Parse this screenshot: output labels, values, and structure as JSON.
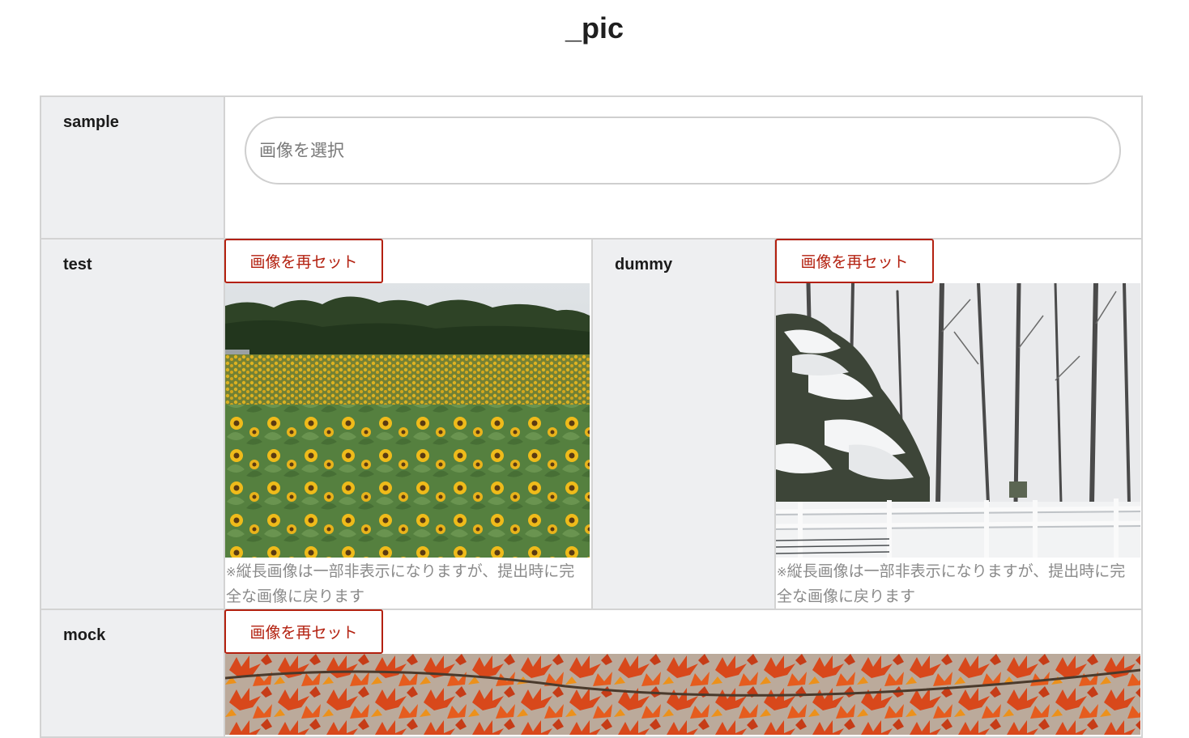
{
  "page": {
    "title": "_pic"
  },
  "fields": [
    {
      "label": "sample",
      "placeholder": "画像を選択"
    },
    {
      "label": "test",
      "reset_label": "画像を再セット",
      "note_mark": "※",
      "note": "縦長画像は一部非表示になりますが、提出時に完全な画像に戻ります",
      "image": "sunflower-field-photo"
    },
    {
      "label": "dummy",
      "reset_label": "画像を再セット",
      "note_mark": "※",
      "note": "縦長画像は一部非表示になりますが、提出時に完全な画像に戻ります",
      "image": "snowy-forest-photo"
    },
    {
      "label": "mock",
      "reset_label": "画像を再セット",
      "image": "autumn-maple-leaves-photo"
    }
  ],
  "colors": {
    "accent": "#b3200f",
    "label_bg": "#eeeff1",
    "border": "#d3d3d3",
    "note_text": "#8a8a8a"
  }
}
